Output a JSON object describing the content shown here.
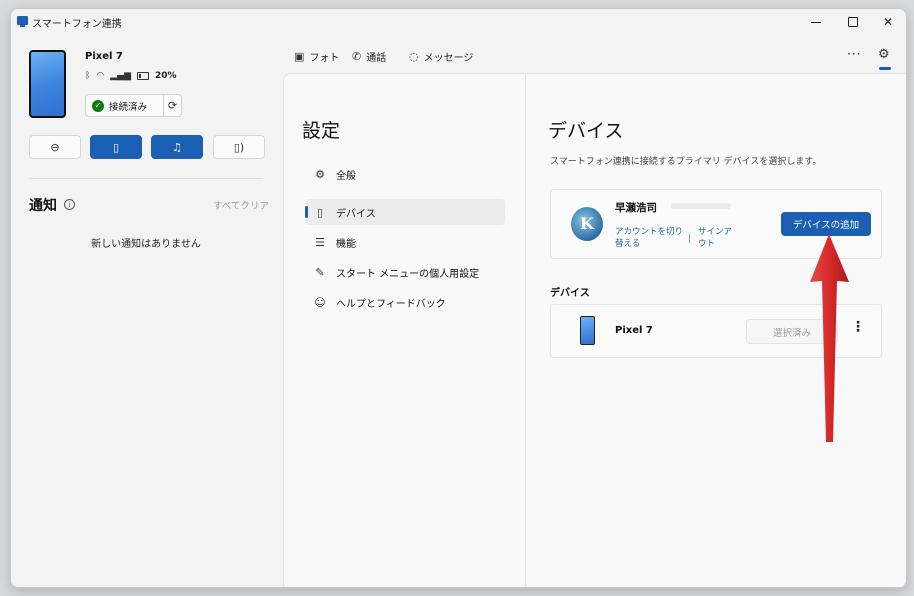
{
  "window": {
    "title": "スマートフォン連携"
  },
  "phone": {
    "name": "Pixel 7",
    "battery": "20%",
    "connection_label": "接続済み"
  },
  "quick_actions": [
    {
      "name": "do-not-disturb",
      "icon": "minus-circle-icon",
      "active": false
    },
    {
      "name": "vibrate",
      "icon": "vibrate-icon",
      "active": true
    },
    {
      "name": "music",
      "icon": "music-icon",
      "active": true
    },
    {
      "name": "audio-output",
      "icon": "phone-audio-icon",
      "active": false
    }
  ],
  "notifications": {
    "title": "通知",
    "clear_all": "すべてクリア",
    "empty": "新しい通知はありません"
  },
  "topnav": {
    "photos": "フォト",
    "calls": "通話",
    "messages": "メッセージ"
  },
  "settings": {
    "heading": "設定",
    "items": [
      {
        "label": "全般",
        "icon": "gear-icon"
      },
      {
        "label": "デバイス",
        "icon": "phone-icon"
      },
      {
        "label": "機能",
        "icon": "list-icon"
      },
      {
        "label": "スタート メニューの個人用設定",
        "icon": "pen-icon"
      },
      {
        "label": "ヘルプとフィードバック",
        "icon": "help-icon"
      }
    ],
    "active_index": 1
  },
  "detail": {
    "title": "デバイス",
    "description": "スマートフォン連携に接続するプライマリ デバイスを選択します。",
    "account": {
      "name": "早瀬浩司",
      "switch_link": "アカウントを切り替える",
      "signout_link": "サインアウト",
      "add_device": "デバイスの追加"
    },
    "devices_label": "デバイス",
    "device": {
      "name": "Pixel 7",
      "selected_label": "選択済み"
    }
  },
  "colors": {
    "accent": "#1a5fb4",
    "annotation_arrow": "#d62a2a"
  }
}
